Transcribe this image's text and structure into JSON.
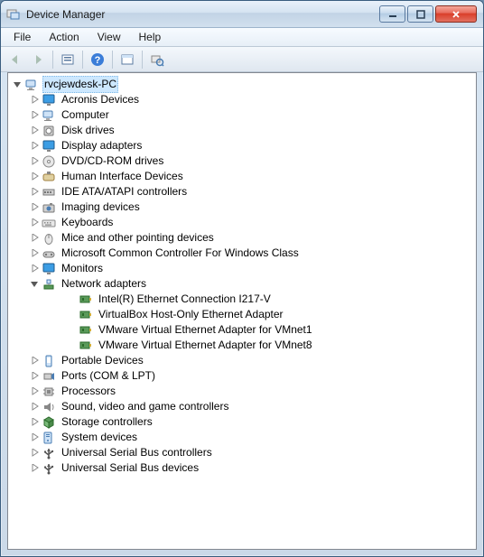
{
  "window": {
    "title": "Device Manager"
  },
  "menubar": {
    "items": [
      "File",
      "Action",
      "View",
      "Help"
    ]
  },
  "toolbar": {
    "back": "Back",
    "forward": "Forward",
    "show_hidden": "Show hidden",
    "help": "Help",
    "properties": "Properties",
    "scan": "Scan for hardware changes"
  },
  "tree": {
    "root": {
      "label": "rvcjewdesk-PC",
      "icon": "computer",
      "expanded": true
    },
    "categories": [
      {
        "label": "Acronis Devices",
        "icon": "monitor"
      },
      {
        "label": "Computer",
        "icon": "computer"
      },
      {
        "label": "Disk drives",
        "icon": "disk"
      },
      {
        "label": "Display adapters",
        "icon": "monitor"
      },
      {
        "label": "DVD/CD-ROM drives",
        "icon": "disc"
      },
      {
        "label": "Human Interface Devices",
        "icon": "hid"
      },
      {
        "label": "IDE ATA/ATAPI controllers",
        "icon": "ide"
      },
      {
        "label": "Imaging devices",
        "icon": "camera"
      },
      {
        "label": "Keyboards",
        "icon": "keyboard"
      },
      {
        "label": "Mice and other pointing devices",
        "icon": "mouse"
      },
      {
        "label": "Microsoft Common Controller For Windows Class",
        "icon": "controller"
      },
      {
        "label": "Monitors",
        "icon": "monitor"
      },
      {
        "label": "Network adapters",
        "icon": "network",
        "expanded": true,
        "children": [
          {
            "label": "Intel(R) Ethernet Connection I217-V",
            "icon": "nic"
          },
          {
            "label": "VirtualBox Host-Only Ethernet Adapter",
            "icon": "nic"
          },
          {
            "label": "VMware Virtual Ethernet Adapter for VMnet1",
            "icon": "nic"
          },
          {
            "label": "VMware Virtual Ethernet Adapter for VMnet8",
            "icon": "nic"
          }
        ]
      },
      {
        "label": "Portable Devices",
        "icon": "portable"
      },
      {
        "label": "Ports (COM & LPT)",
        "icon": "port"
      },
      {
        "label": "Processors",
        "icon": "cpu"
      },
      {
        "label": "Sound, video and game controllers",
        "icon": "sound"
      },
      {
        "label": "Storage controllers",
        "icon": "storage"
      },
      {
        "label": "System devices",
        "icon": "system"
      },
      {
        "label": "Universal Serial Bus controllers",
        "icon": "usb"
      },
      {
        "label": "Universal Serial Bus devices",
        "icon": "usb"
      }
    ]
  }
}
